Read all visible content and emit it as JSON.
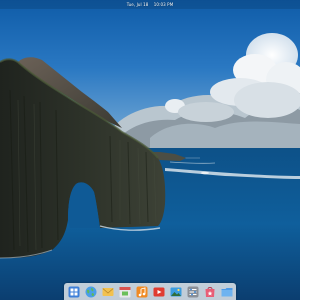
{
  "top_panel": {
    "date": "Tue, Jul 18",
    "time": "10:03 PM"
  },
  "wallpaper": {
    "subject": "sea-arch-cliff"
  },
  "dock": {
    "items": [
      {
        "name": "multitasking-view",
        "icon": "multitasking-icon",
        "color": "#3d7fd9"
      },
      {
        "name": "web-browser",
        "icon": "globe-icon",
        "color": "#4a9ee8"
      },
      {
        "name": "mail",
        "icon": "mail-icon",
        "color": "#f2c14e"
      },
      {
        "name": "calendar",
        "icon": "calendar-icon",
        "color": "#e8e8e8"
      },
      {
        "name": "music",
        "icon": "music-icon",
        "color": "#f08a24"
      },
      {
        "name": "videos",
        "icon": "video-icon",
        "color": "#e03c31"
      },
      {
        "name": "photos",
        "icon": "photos-icon",
        "color": "#3b9de0"
      },
      {
        "name": "system-settings",
        "icon": "settings-icon",
        "color": "#8a8f97"
      },
      {
        "name": "app-center",
        "icon": "app-center-icon",
        "color": "#e85d75"
      },
      {
        "name": "files",
        "icon": "folder-icon",
        "color": "#4c9be8"
      }
    ]
  }
}
